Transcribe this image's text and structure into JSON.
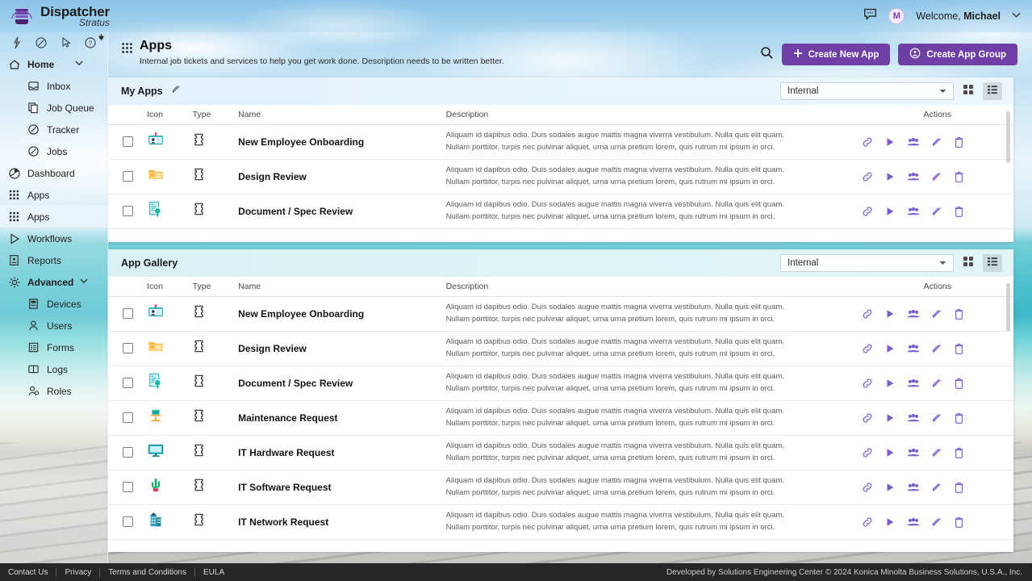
{
  "brand": {
    "name": "Dispatcher",
    "sub": "Stratus",
    "logo_icon": "stratus-logo-icon"
  },
  "topbar": {
    "chat_icon": "chat-bubble-icon",
    "avatar_initial": "M",
    "welcome_prefix": "Welcome, ",
    "user_name": "Michael",
    "caret": "⌄"
  },
  "sidebar": {
    "tools": [
      {
        "icon": "lightning-icon",
        "name": "quick-actions"
      },
      {
        "icon": "check-circle-icon",
        "name": "tasks"
      },
      {
        "icon": "cursor-add-icon",
        "name": "pointer-add"
      },
      {
        "icon": "help-circle-icon",
        "name": "help"
      }
    ],
    "pin_icon": "pin-icon",
    "items": [
      {
        "label": "Home",
        "icon": "home-icon",
        "type": "group",
        "expanded": true
      },
      {
        "label": "Inbox",
        "icon": "inbox-icon",
        "type": "sub"
      },
      {
        "label": "Job Queue",
        "icon": "job-queue-icon",
        "type": "sub"
      },
      {
        "label": "Tracker",
        "icon": "tracker-icon",
        "type": "sub"
      },
      {
        "label": "Jobs",
        "icon": "jobs-icon",
        "type": "sub"
      },
      {
        "label": "Dashboard",
        "icon": "dashboard-icon",
        "type": "item"
      },
      {
        "label": "Apps",
        "icon": "apps-grid-icon",
        "type": "item"
      },
      {
        "label": "Apps",
        "icon": "apps-grid-icon",
        "type": "item",
        "active": true
      },
      {
        "label": "Workflows",
        "icon": "workflows-play-icon",
        "type": "item"
      },
      {
        "label": "Reports",
        "icon": "reports-icon",
        "type": "item"
      },
      {
        "label": "Advanced",
        "icon": "gear-icon",
        "type": "group",
        "expanded": true
      },
      {
        "label": "Devices",
        "icon": "devices-icon",
        "type": "sub"
      },
      {
        "label": "Users",
        "icon": "user-icon",
        "type": "sub"
      },
      {
        "label": "Forms",
        "icon": "forms-icon",
        "type": "sub"
      },
      {
        "label": "Logs",
        "icon": "logs-book-icon",
        "type": "sub"
      },
      {
        "label": "Roles",
        "icon": "roles-icon",
        "type": "sub"
      }
    ]
  },
  "page": {
    "icon": "apps-grid-icon",
    "title": "Apps",
    "description": "Internal job tickets and services to help you get work done. Description needs to be written better.",
    "search_icon": "search-icon",
    "create_app_label": "Create New App",
    "create_app_icon": "plus-icon",
    "create_group_label": "Create App Group",
    "create_group_icon": "app-group-icon",
    "accent_color": "#6e3fa5"
  },
  "table_headers": {
    "icon": "Icon",
    "type": "Type",
    "name": "Name",
    "description": "Description",
    "actions": "Actions"
  },
  "row_actions": [
    {
      "name": "link-icon",
      "title": "Link"
    },
    {
      "name": "play-icon",
      "title": "Run"
    },
    {
      "name": "people-icon",
      "title": "Share"
    },
    {
      "name": "pencil-icon",
      "title": "Edit"
    },
    {
      "name": "trash-icon",
      "title": "Delete"
    }
  ],
  "shared_description_line1": "Aliquam id dapibus odio. Duis sodales augue mattis magna viverra vestibulum. Nulla quis elit quam.",
  "shared_description_line2": "Nullam porttitor, turpis nec pulvinar aliquet, urna urna pretium lorem, quis rutrum mi ipsum in orci.",
  "my_apps": {
    "title": "My Apps",
    "edit_icon": "pencil-icon",
    "filter_value": "Internal",
    "filter_caret": "▾",
    "view_grid_icon": "grid-view-icon",
    "view_list_icon": "list-view-icon",
    "active_view": "list",
    "rows": [
      {
        "name": "New Employee Onboarding",
        "icon": "id-badge-icon",
        "type_icon": "ticket-icon"
      },
      {
        "name": "Design Review",
        "icon": "folder-image-icon",
        "type_icon": "ticket-icon"
      },
      {
        "name": "Document / Spec Review",
        "icon": "document-search-icon",
        "type_icon": "ticket-icon"
      }
    ]
  },
  "app_gallery": {
    "title": "App Gallery",
    "filter_value": "Internal",
    "filter_caret": "▾",
    "view_grid_icon": "grid-view-icon",
    "view_list_icon": "list-view-icon",
    "active_view": "list",
    "rows": [
      {
        "name": "New Employee Onboarding",
        "icon": "id-badge-icon",
        "type_icon": "ticket-icon"
      },
      {
        "name": "Design Review",
        "icon": "folder-image-icon",
        "type_icon": "ticket-icon"
      },
      {
        "name": "Document / Spec Review",
        "icon": "document-search-icon",
        "type_icon": "ticket-icon"
      },
      {
        "name": "Maintenance Request",
        "icon": "desk-chair-icon",
        "type_icon": "ticket-icon"
      },
      {
        "name": "IT Hardware Request",
        "icon": "monitor-icon",
        "type_icon": "ticket-icon"
      },
      {
        "name": "IT Software Request",
        "icon": "cactus-icon",
        "type_icon": "ticket-icon"
      },
      {
        "name": "IT Network Request",
        "icon": "building-icon",
        "type_icon": "ticket-icon"
      }
    ]
  },
  "footer": {
    "links": [
      "Contact Us",
      "Privacy",
      "Terms and Conditions",
      "EULA"
    ],
    "copyright": "Developed by Solutions Engineering Center  © 2024 Konica Minolta Business Solutions, U.S.A., Inc."
  }
}
